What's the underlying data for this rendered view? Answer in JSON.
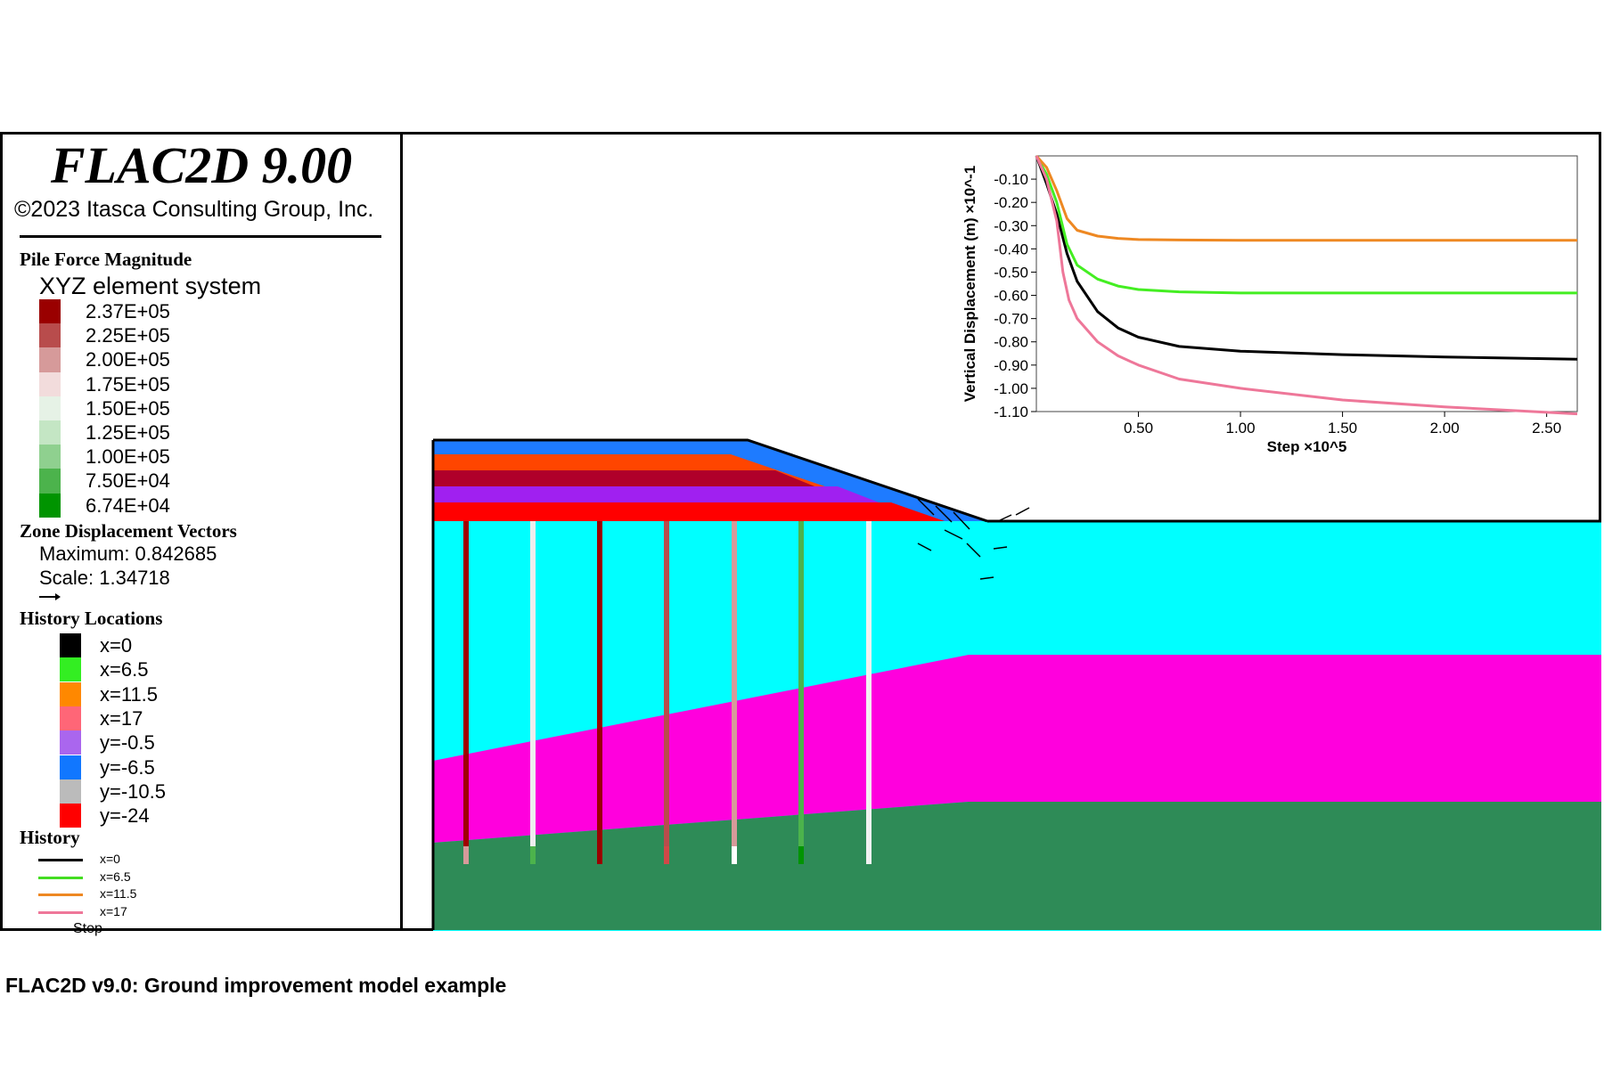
{
  "app": {
    "title": "FLAC2D 9.00",
    "copyright": "©2023 Itasca Consulting Group, Inc."
  },
  "legend": {
    "pile_force": {
      "title": "Pile Force Magnitude",
      "subtitle": "XYZ element system",
      "ranges": [
        {
          "label": "2.37E+05",
          "color": "#9a0000"
        },
        {
          "label": "2.25E+05",
          "color": "#b84c4c"
        },
        {
          "label": "2.00E+05",
          "color": "#d69a9a"
        },
        {
          "label": "1.75E+05",
          "color": "#f2dcdc"
        },
        {
          "label": "1.50E+05",
          "color": "#e6f2e6"
        },
        {
          "label": "1.25E+05",
          "color": "#c4e6c4"
        },
        {
          "label": "1.00E+05",
          "color": "#8fd08f"
        },
        {
          "label": "7.50E+04",
          "color": "#4cb34c"
        },
        {
          "label": "6.74E+04",
          "color": "#009400"
        }
      ]
    },
    "zone_displacement": {
      "title": "Zone Displacement Vectors",
      "maximum": "Maximum: 0.842685",
      "scale": "Scale: 1.34718"
    },
    "history_locations": {
      "title": "History Locations",
      "items": [
        {
          "label": "x=0",
          "color": "#000000"
        },
        {
          "label": "x=6.5",
          "color": "#33ee22"
        },
        {
          "label": "x=11.5",
          "color": "#ff8800"
        },
        {
          "label": "x=17",
          "color": "#ff6677"
        },
        {
          "label": "y=-0.5",
          "color": "#aa66ee"
        },
        {
          "label": "y=-6.5",
          "color": "#1177ff"
        },
        {
          "label": "y=-10.5",
          "color": "#bbbbbb"
        },
        {
          "label": "y=-24",
          "color": "#ff0000"
        }
      ]
    },
    "history": {
      "title": "History",
      "items": [
        {
          "label": "x=0",
          "color": "#000000"
        },
        {
          "label": "x=6.5",
          "color": "#44dd22"
        },
        {
          "label": "x=11.5",
          "color": "#ee8822"
        },
        {
          "label": "x=17",
          "color": "#ee7799"
        }
      ],
      "cutoff_label": "Step"
    }
  },
  "model": {
    "layer_colors": {
      "soft_upper": "#00ffff",
      "soft_middle": "#ff00dd",
      "stiff_base": "#2e8b57",
      "embankment_top": "#1e7bff",
      "embankment_2": "#ff4500",
      "embankment_3": "#b0002a",
      "embankment_4": "#a020f0",
      "embankment_5": "#ff0000"
    },
    "piles": [
      {
        "top": "#a00000",
        "bottom": "#d69a9a"
      },
      {
        "top": "#eeeeee",
        "bottom": "#4cb34c"
      },
      {
        "top": "#9a0000",
        "bottom": "#9a0000"
      },
      {
        "top": "#b84c4c",
        "bottom": "#d04848"
      },
      {
        "top": "#d69a9a",
        "bottom": "#ffffff"
      },
      {
        "top": "#4cb34c",
        "bottom": "#009400"
      },
      {
        "top": "#f2f2f2",
        "bottom": "#f2f2f2"
      }
    ]
  },
  "chart_data": {
    "type": "line",
    "title": "",
    "xlabel": "Step ×10^5",
    "ylabel": "Vertical Displacement (m) ×10^-1",
    "xlim": [
      0,
      2.65
    ],
    "ylim": [
      -1.1,
      0.0
    ],
    "x_ticks": [
      "0.50",
      "1.00",
      "1.50",
      "2.00",
      "2.50"
    ],
    "y_ticks": [
      "-0.10",
      "-0.20",
      "-0.30",
      "-0.40",
      "-0.50",
      "-0.60",
      "-0.70",
      "-0.80",
      "-0.90",
      "-1.00",
      "-1.10"
    ],
    "series": [
      {
        "name": "x=0",
        "color": "#000000",
        "x": [
          0,
          0.05,
          0.1,
          0.15,
          0.2,
          0.3,
          0.4,
          0.5,
          0.7,
          1.0,
          1.5,
          2.0,
          2.65
        ],
        "values": [
          0,
          -0.12,
          -0.25,
          -0.42,
          -0.54,
          -0.67,
          -0.74,
          -0.78,
          -0.82,
          -0.84,
          -0.855,
          -0.865,
          -0.875
        ]
      },
      {
        "name": "x=6.5",
        "color": "#44ee22",
        "x": [
          0,
          0.05,
          0.1,
          0.15,
          0.2,
          0.3,
          0.4,
          0.5,
          0.7,
          1.0,
          1.5,
          2.0,
          2.65
        ],
        "values": [
          0,
          -0.08,
          -0.2,
          -0.38,
          -0.47,
          -0.53,
          -0.56,
          -0.575,
          -0.585,
          -0.59,
          -0.59,
          -0.59,
          -0.59
        ]
      },
      {
        "name": "x=11.5",
        "color": "#ee8822",
        "x": [
          0,
          0.05,
          0.1,
          0.15,
          0.2,
          0.3,
          0.4,
          0.5,
          0.7,
          1.0,
          1.5,
          2.0,
          2.65
        ],
        "values": [
          0,
          -0.05,
          -0.15,
          -0.27,
          -0.32,
          -0.345,
          -0.355,
          -0.36,
          -0.362,
          -0.363,
          -0.363,
          -0.363,
          -0.363
        ]
      },
      {
        "name": "x=17",
        "color": "#ee7799",
        "x": [
          0,
          0.05,
          0.1,
          0.13,
          0.16,
          0.2,
          0.3,
          0.4,
          0.5,
          0.7,
          1.0,
          1.5,
          2.0,
          2.65
        ],
        "values": [
          0,
          -0.1,
          -0.28,
          -0.5,
          -0.62,
          -0.7,
          -0.8,
          -0.86,
          -0.9,
          -0.96,
          -1.0,
          -1.05,
          -1.08,
          -1.11
        ]
      }
    ]
  },
  "caption": "FLAC2D v9.0: Ground improvement model example"
}
